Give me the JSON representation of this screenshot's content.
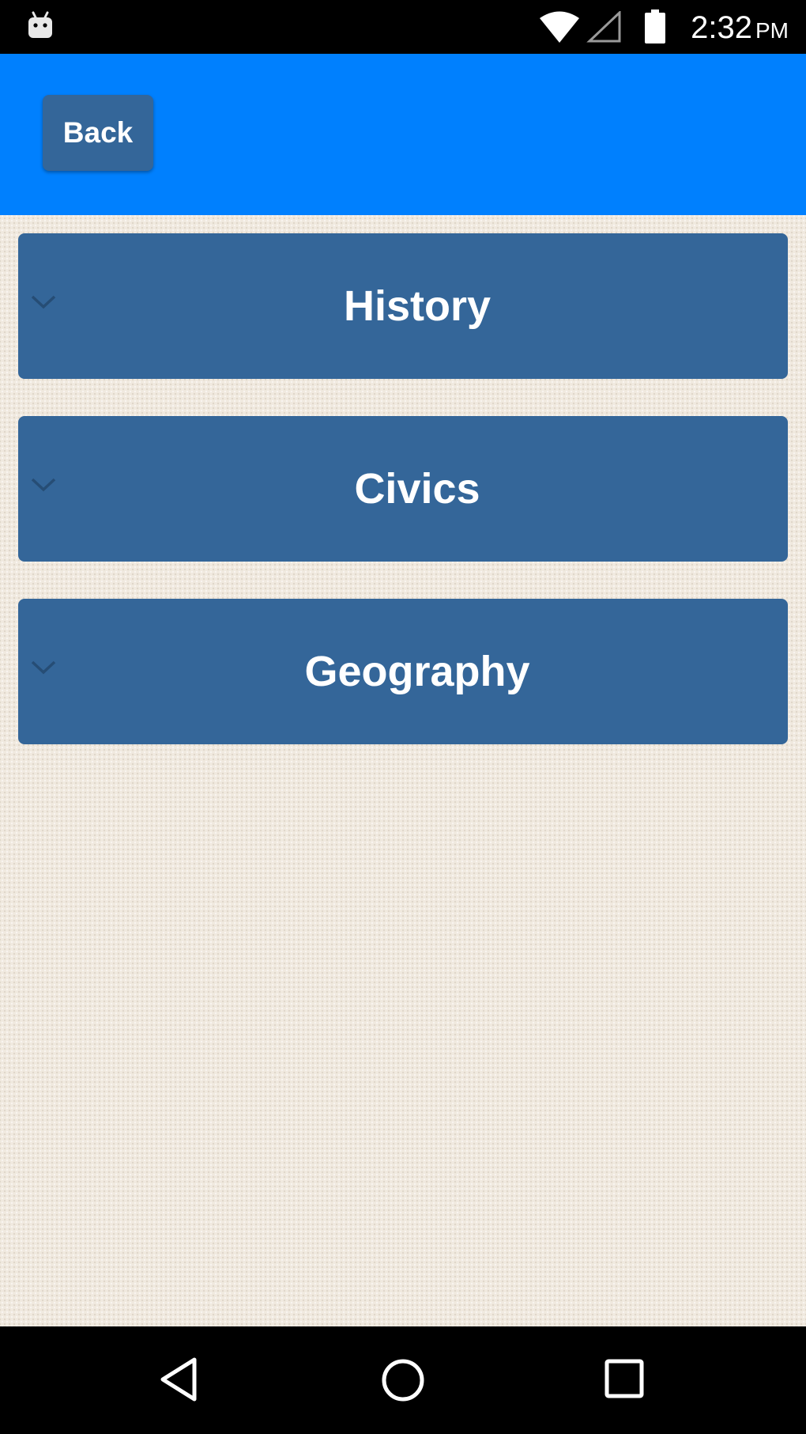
{
  "status_bar": {
    "time": "2:32",
    "ampm": "PM",
    "icons": [
      "android-icon",
      "wifi-icon",
      "signal-icon",
      "battery-icon"
    ]
  },
  "header": {
    "back_label": "Back",
    "background_color": "#0080fe",
    "button_color": "#346699"
  },
  "accordion": {
    "items": [
      {
        "label": "History",
        "icon": "chevron-down-icon"
      },
      {
        "label": "Civics",
        "icon": "chevron-down-icon"
      },
      {
        "label": "Geography",
        "icon": "chevron-down-icon"
      }
    ],
    "item_color": "#346699"
  },
  "nav_bar": {
    "buttons": [
      "back-triangle-icon",
      "home-circle-icon",
      "recents-square-icon"
    ]
  }
}
